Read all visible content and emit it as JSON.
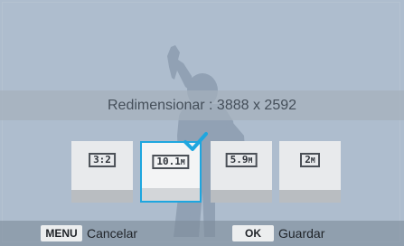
{
  "screen": {
    "title": "Redimensionar : 3888 x 2592"
  },
  "options": [
    {
      "icon": "aspect-3-2-icon",
      "main": "3:2",
      "unit": "",
      "selected": false
    },
    {
      "icon": "size-10-1m-icon",
      "main": "10.1",
      "unit": "M",
      "selected": true
    },
    {
      "icon": "size-5-9m-icon",
      "main": "5.9",
      "unit": "M",
      "selected": false
    },
    {
      "icon": "size-2m-icon",
      "main": "2",
      "unit": "M",
      "selected": false
    }
  ],
  "footer": {
    "menu_key": "MENU",
    "cancel_label": "Cancelar",
    "ok_key": "OK",
    "save_label": "Guardar"
  },
  "colors": {
    "accent": "#1ea6df",
    "background": "#aebdce"
  }
}
